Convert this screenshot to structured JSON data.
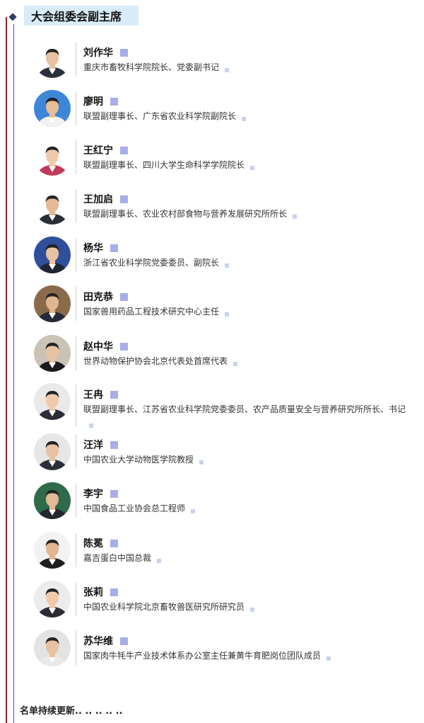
{
  "section": {
    "title": "大会组委会副主席"
  },
  "people": [
    {
      "name": "刘作华",
      "title": "重庆市畜牧科学院院长、党委副书记",
      "bg": "#ffffff",
      "suit": "#2b2f3a",
      "skin": "#e8c2a0"
    },
    {
      "name": "廖明",
      "title": "联盟副理事长、广东省农业科学院副院长",
      "bg": "#3e86d8",
      "suit": "#f2f2f2",
      "skin": "#e6bd98"
    },
    {
      "name": "王红宁",
      "title": "联盟副理事长、四川大学生命科学学院院长",
      "bg": "#ffffff",
      "suit": "#c23a5a",
      "skin": "#efc9aa"
    },
    {
      "name": "王加启",
      "title": "联盟副理事长、农业农村部食物与营养发展研究所所长",
      "bg": "#ffffff",
      "suit": "#2a2e38",
      "skin": "#e4b995"
    },
    {
      "name": "杨华",
      "title": "浙江省农业科学院党委委员、副院长",
      "bg": "#2f4f9a",
      "suit": "#1f2633",
      "skin": "#e8c2a0"
    },
    {
      "name": "田克恭",
      "title": "国家兽用药品工程技术研究中心主任",
      "bg": "#8a6a4a",
      "suit": "#262a36",
      "skin": "#e0b590"
    },
    {
      "name": "赵中华",
      "title": "世界动物保护协会北京代表处首席代表",
      "bg": "#c9c2b5",
      "suit": "#1b1b1b",
      "skin": "#e8c2a0"
    },
    {
      "name": "王冉",
      "title": "联盟副理事长、江苏省农业科学院党委委员、农产品质量安全与营养研究所所长、书记",
      "bg": "#e9e9e9",
      "suit": "#2c2c34",
      "skin": "#efc9aa"
    },
    {
      "name": "汪洋",
      "title": "中国农业大学动物医学院教授",
      "bg": "#e6e6e6",
      "suit": "#2a2e38",
      "skin": "#e8c2a0"
    },
    {
      "name": "李宇",
      "title": "中国食品工业协会总工程师",
      "bg": "#2f6b4a",
      "suit": "#23262e",
      "skin": "#e4b995"
    },
    {
      "name": "陈冕",
      "title": "嘉吉蛋白中国总裁",
      "bg": "#f2f2f2",
      "suit": "#1e1e1e",
      "skin": "#e0b590"
    },
    {
      "name": "张莉",
      "title": "中国农业科学院北京畜牧兽医研究所研究员",
      "bg": "#ececec",
      "suit": "#2c2c34",
      "skin": "#efc9aa"
    },
    {
      "name": "苏华维",
      "title": "国家肉牛牦牛产业技术体系办公室主任兼黄牛育肥岗位团队成员",
      "bg": "#e3e3e3",
      "suit": "#e9e9e9",
      "skin": "#e8c2a0"
    }
  ],
  "footer": "名单持续更新.. .. .. .. .."
}
